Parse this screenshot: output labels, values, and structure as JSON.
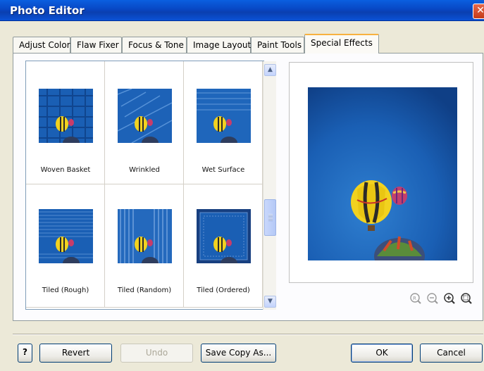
{
  "window": {
    "title": "Photo Editor",
    "close_glyph": "✕"
  },
  "tabs": [
    {
      "label": "Adjust Color",
      "active": false
    },
    {
      "label": "Flaw Fixer",
      "active": false
    },
    {
      "label": "Focus & Tone",
      "active": false
    },
    {
      "label": "Image Layout",
      "active": false
    },
    {
      "label": "Paint Tools",
      "active": false
    },
    {
      "label": "Special Effects",
      "active": true
    }
  ],
  "effects": [
    {
      "label": "Woven Basket"
    },
    {
      "label": "Wrinkled"
    },
    {
      "label": "Wet Surface"
    },
    {
      "label": "Tiled (Rough)"
    },
    {
      "label": "Tiled (Random)"
    },
    {
      "label": "Tiled (Ordered)"
    }
  ],
  "scrollbar": {
    "up_glyph": "▲",
    "down_glyph": "▼"
  },
  "preview": {
    "zoom_buttons": [
      "zoom-reset-icon",
      "zoom-out-icon",
      "zoom-in-icon",
      "zoom-fit-icon"
    ]
  },
  "buttons": {
    "help": "?",
    "revert": "Revert",
    "undo": "Undo",
    "save_copy": "Save Copy As...",
    "ok": "OK",
    "cancel": "Cancel"
  },
  "colors": {
    "sky": "#1a5fb4",
    "titlebar": "#0847c4",
    "balloon_yellow": "#f2d21f"
  }
}
